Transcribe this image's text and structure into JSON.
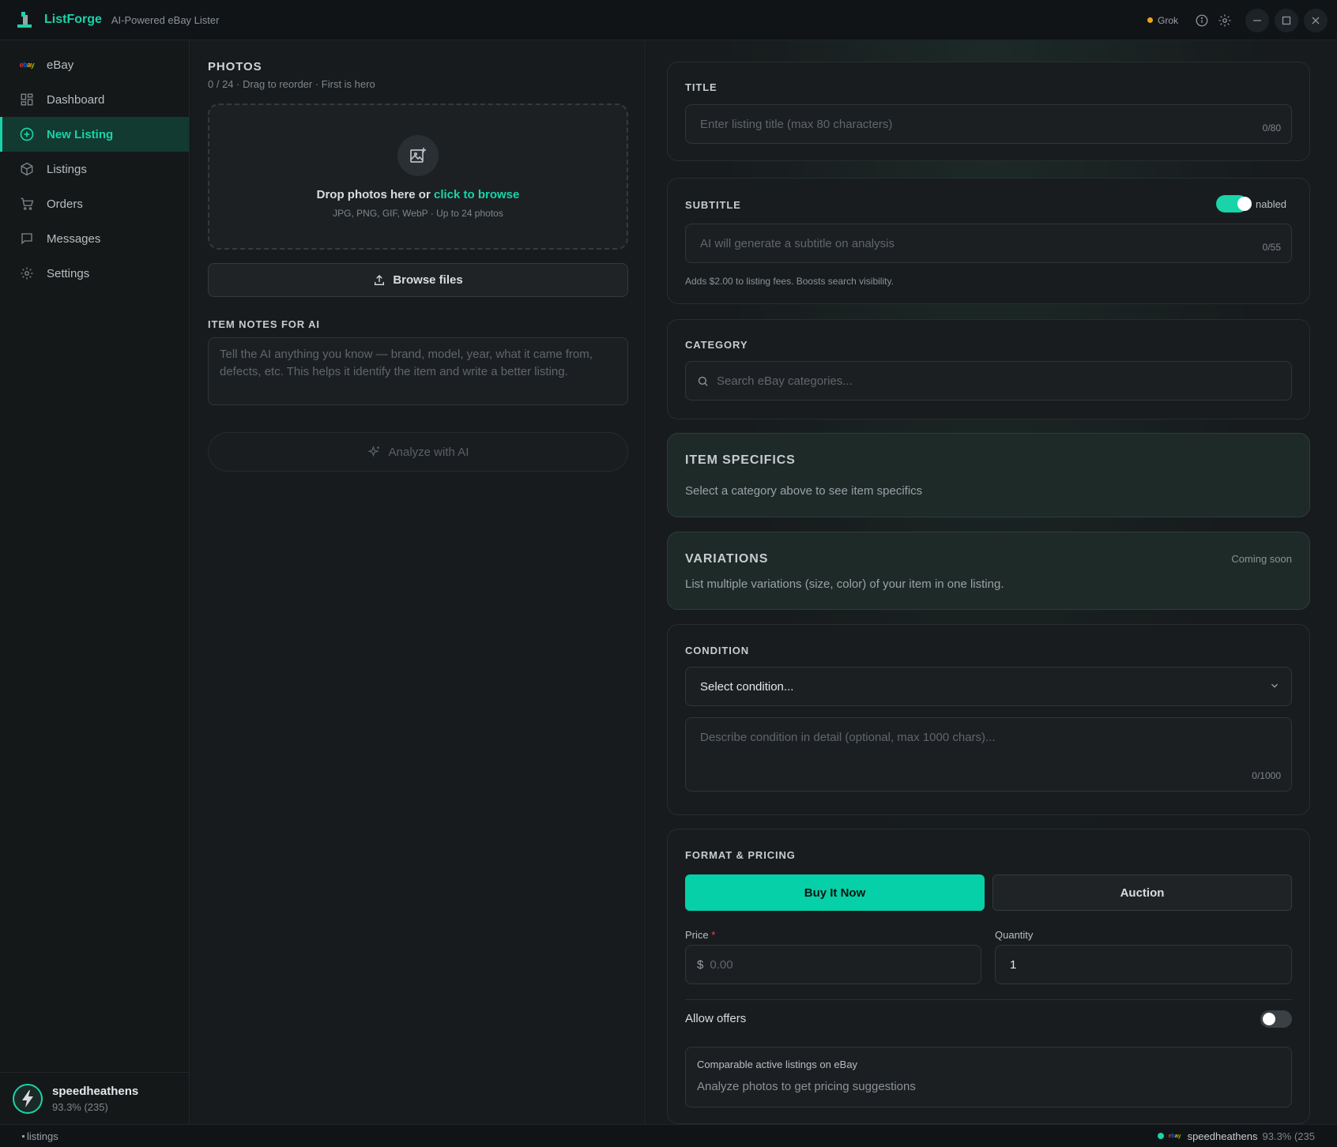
{
  "app": {
    "name": "ListForge",
    "tagline": "AI-Powered eBay Lister",
    "provider": "Grok",
    "accent_color": "#19d3a9",
    "provider_dot_color": "#f0a024"
  },
  "sidebar": {
    "items": [
      {
        "label": "eBay",
        "icon": "ebay-logo-icon",
        "active": false
      },
      {
        "label": "Dashboard",
        "icon": "dashboard-grid-icon",
        "active": false
      },
      {
        "label": "New Listing",
        "icon": "plus-circle-icon",
        "active": true
      },
      {
        "label": "Listings",
        "icon": "package-box-icon",
        "active": false
      },
      {
        "label": "Orders",
        "icon": "cart-icon",
        "active": false
      },
      {
        "label": "Messages",
        "icon": "message-icon",
        "active": false
      },
      {
        "label": "Settings",
        "icon": "gear-icon",
        "active": false
      }
    ],
    "ebay_logo_text": "ebay",
    "user": {
      "name": "speedheathens",
      "score": "93.3% (235)"
    }
  },
  "photos": {
    "heading": "PHOTOS",
    "subtitle": "0 / 24 · Drag to reorder · First is hero",
    "drop_text": "Drop photos here or",
    "drop_link": "click to browse",
    "drop_sub": "JPG, PNG, GIF, WebP · Up to 24 photos",
    "browse_label": "Browse files"
  },
  "notes": {
    "label": "ITEM NOTES FOR AI",
    "placeholder": "Tell the AI anything you know — brand, model, year, what it came from, defects, etc. This helps it identify the item and write a better listing."
  },
  "analyze_label": "Analyze with AI",
  "title_card": {
    "label": "TITLE",
    "placeholder": "Enter listing title (max 80 characters)",
    "counter": "0/80"
  },
  "subtitle_card": {
    "label": "SUBTITLE",
    "toggle_text": "nabled",
    "toggle_on": true,
    "placeholder": "AI will generate a subtitle on analysis",
    "counter": "0/55",
    "note": "Adds $2.00 to listing fees. Boosts search visibility."
  },
  "category_card": {
    "label": "CATEGORY",
    "placeholder": "Search eBay categories..."
  },
  "specifics_card": {
    "heading": "ITEM SPECIFICS",
    "text": "Select a category above to see item specifics"
  },
  "variations_card": {
    "heading": "VARIATIONS",
    "badge": "Coming soon",
    "text": "List multiple variations (size, color) of your item in one listing."
  },
  "condition_card": {
    "label": "CONDITION",
    "select_value": "Select condition...",
    "detail_placeholder": "Describe condition in detail (optional, max 1000 chars)...",
    "counter": "0/1000"
  },
  "pricing_card": {
    "label": "FORMAT & PRICING",
    "buy_it_now": "Buy It Now",
    "auction": "Auction",
    "selected_format": "Buy It Now",
    "price_label": "Price",
    "required_mark": "*",
    "currency": "$",
    "price_placeholder": "0.00",
    "quantity_label": "Quantity",
    "quantity_value": "1",
    "allow_offers": "Allow offers",
    "allow_offers_on": false,
    "comparables_title": "Comparable active listings on eBay",
    "comparables_text": "Analyze photos to get pricing suggestions"
  },
  "statusbar": {
    "left_text": "listings",
    "user": "speedheathens",
    "score": "93.3% (235"
  }
}
